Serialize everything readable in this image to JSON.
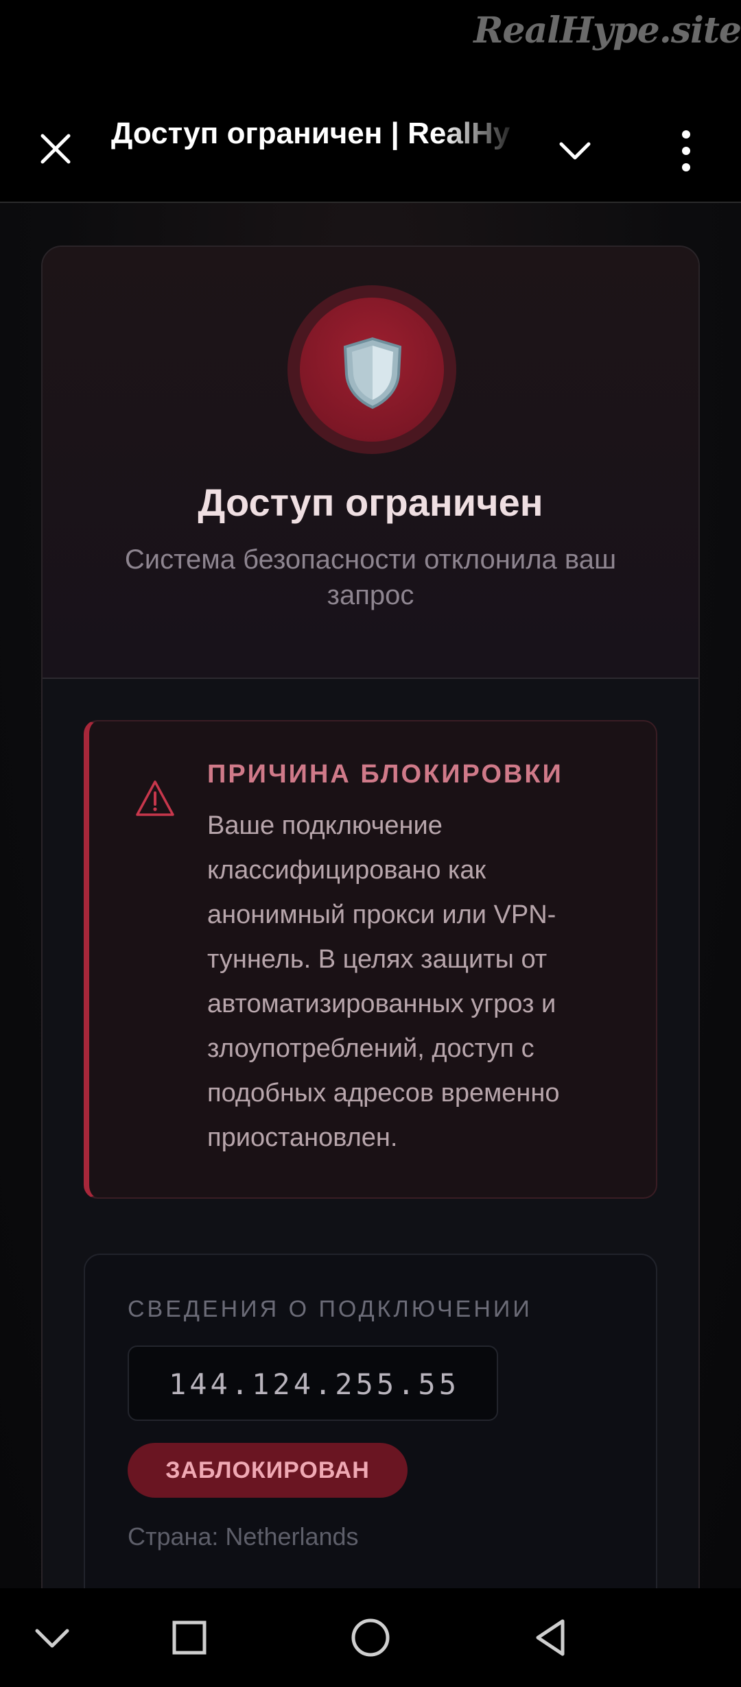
{
  "watermark": "RealHype.site",
  "header": {
    "title": "Доступ ограничен | RealHy",
    "close_icon": "close-icon",
    "chevron_icon": "chevron-down-icon",
    "more_icon": "more-vert-icon"
  },
  "card": {
    "icon": "shield-icon",
    "title": "Доступ ограничен",
    "subtitle": "Система безопасности отклонила ваш запрос"
  },
  "reason": {
    "icon": "warning-icon",
    "title": "ПРИЧИНА БЛОКИРОВКИ",
    "text": "Ваше подключение классифицировано как анонимный прокси или VPN-туннель. В целях защиты от автоматизированных угроз и злоупотреблений, доступ с подобных адресов временно приостановлен."
  },
  "connection": {
    "label": "СВЕДЕНИЯ О ПОДКЛЮЧЕНИИ",
    "ip": "144.124.255.55",
    "status_badge": "ЗАБЛОКИРОВАН",
    "country": "Страна: Netherlands"
  },
  "navbar": {
    "items": [
      "chevron-down-icon",
      "square-icon",
      "circle-icon",
      "triangle-back-icon"
    ]
  },
  "colors": {
    "accent": "#a8273a",
    "badge_bg": "#6a1522",
    "background": "#000000"
  }
}
